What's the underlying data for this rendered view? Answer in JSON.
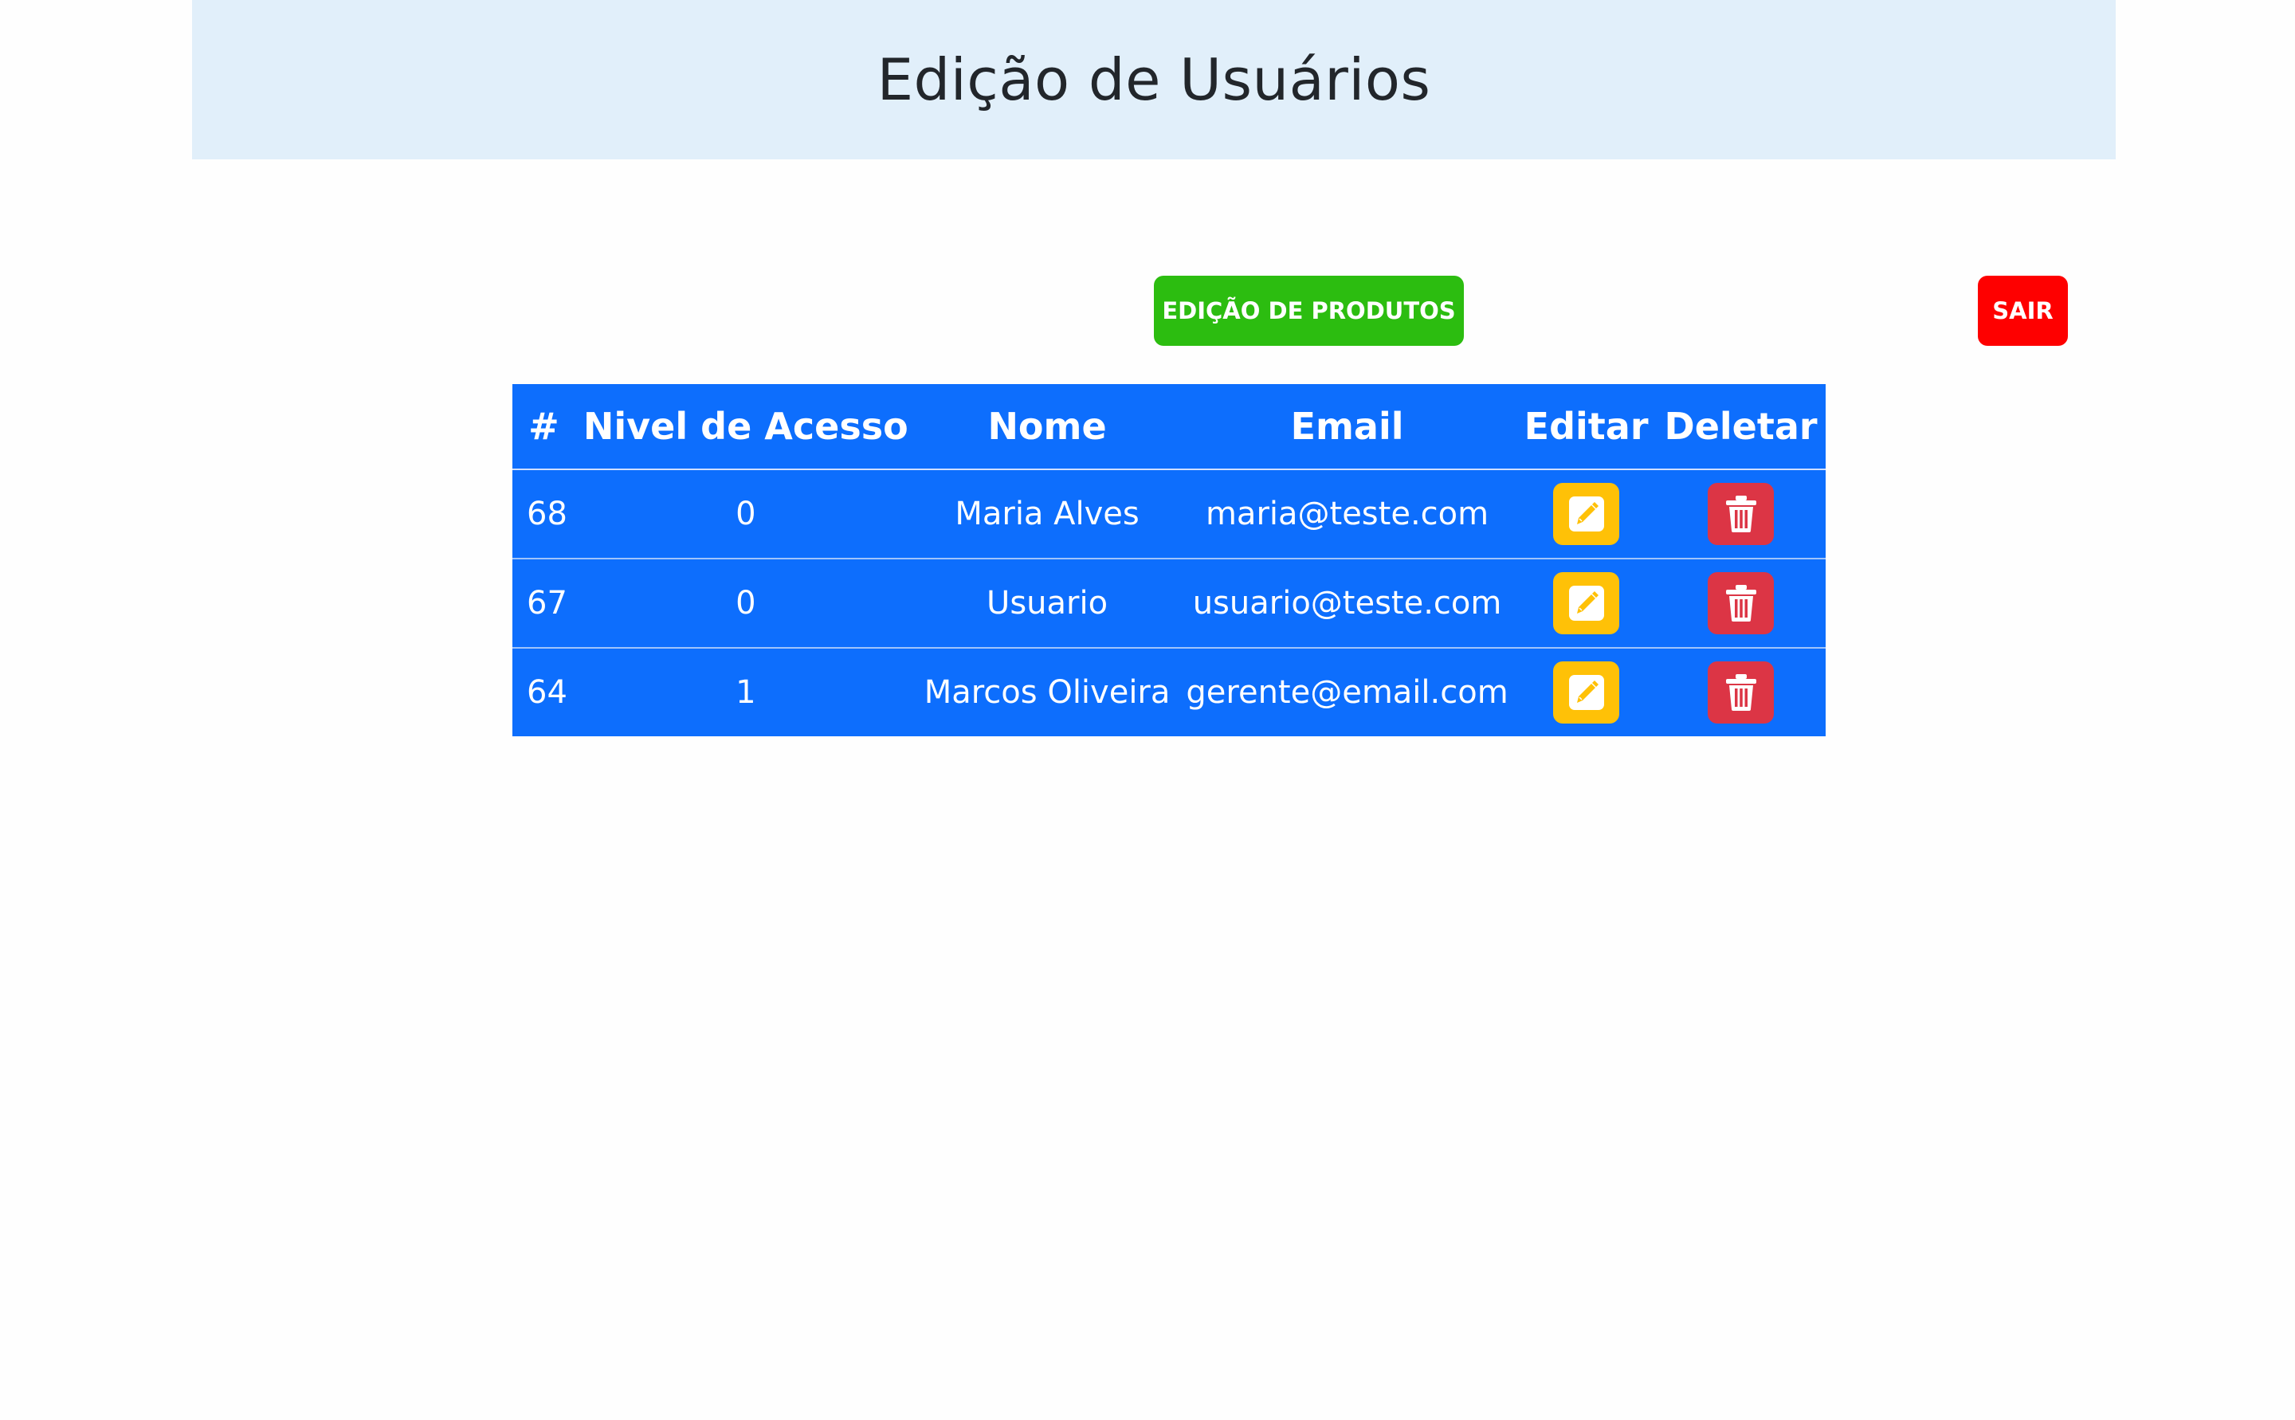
{
  "header": {
    "title": "Edição de Usuários"
  },
  "actions": {
    "produtos_label": "EDIÇÃO DE PRODUTOS",
    "sair_label": "SAIR"
  },
  "table": {
    "columns": [
      "#",
      "Nivel de Acesso",
      "Nome",
      "Email",
      "Editar",
      "Deletar"
    ],
    "rows": [
      {
        "id": "68",
        "nivel": "0",
        "nome": "Maria Alves",
        "email": "maria@teste.com"
      },
      {
        "id": "67",
        "nivel": "0",
        "nome": "Usuario",
        "email": "usuario@teste.com"
      },
      {
        "id": "64",
        "nivel": "1",
        "nome": "Marcos Oliveira",
        "email": "gerente@email.com"
      }
    ]
  },
  "icons": {
    "edit": "pencil-square-icon",
    "delete": "trash-icon"
  },
  "colors": {
    "header_bg": "#e1effa",
    "table_bg": "#0d6efd",
    "produtos_button": "#2cbd10",
    "sair_button": "#fe0000",
    "edit_button": "#ffc107",
    "delete_button": "#dc3545"
  }
}
